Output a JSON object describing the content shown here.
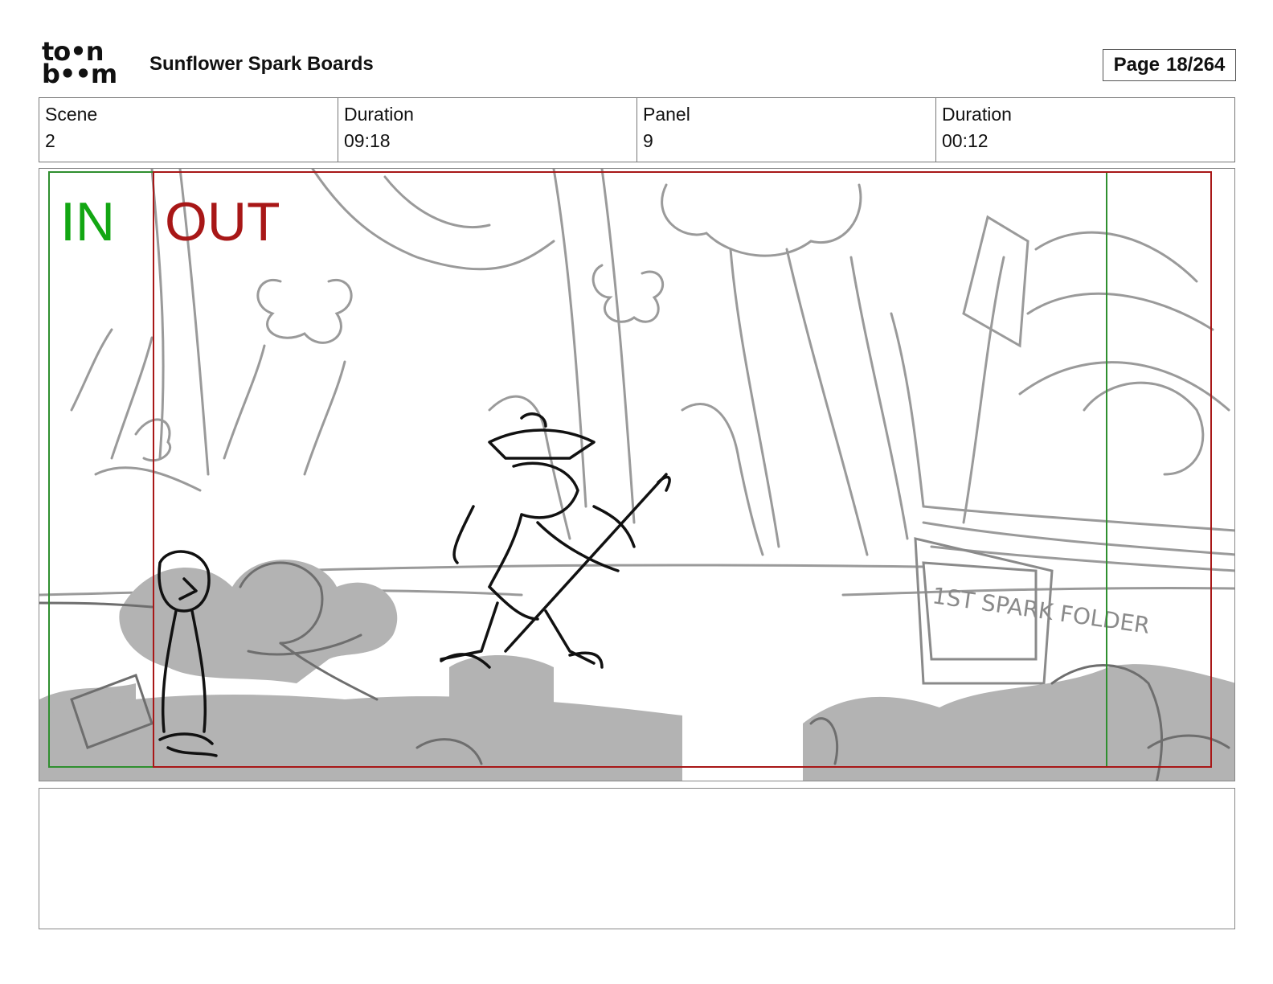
{
  "header": {
    "logo": {
      "line1": "to•n",
      "line2": "b••m",
      "icon": "toonboom-logo"
    },
    "project_title": "Sunflower Spark Boards",
    "page": {
      "label": "Page",
      "value": "18/264"
    }
  },
  "info": [
    {
      "label": "Scene",
      "value": "2"
    },
    {
      "label": "Duration",
      "value": "09:18"
    },
    {
      "label": "Panel",
      "value": "9"
    },
    {
      "label": "Duration",
      "value": "00:12"
    }
  ],
  "panel": {
    "in_label": "IN",
    "out_label": "OUT",
    "sign_text": "1ST SPARK FOLDER",
    "colors": {
      "in": "#12a612",
      "out": "#a81717",
      "sketch": "#8a8a8a",
      "shadow": "#b3b3b3",
      "ink": "#111111"
    }
  },
  "notes": {
    "text": ""
  }
}
